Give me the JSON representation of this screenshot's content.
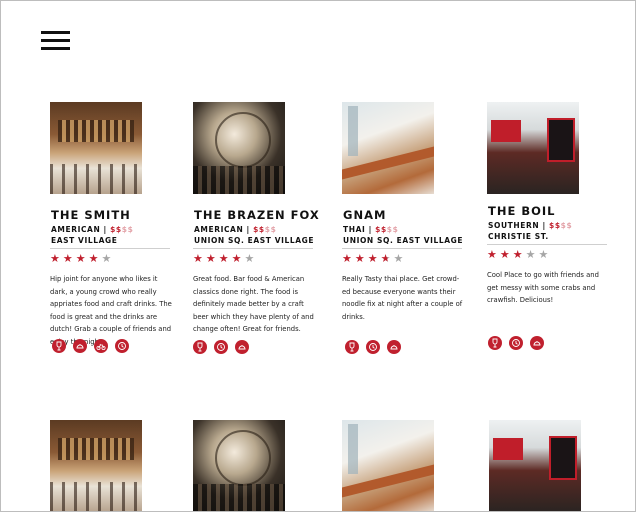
{
  "restaurants": [
    {
      "name": "THE SMITH",
      "cuisine": "AMERICAN",
      "price_on": "$$",
      "price_off": "$$",
      "neighborhood": "EAST VILLAGE",
      "rating": 4,
      "rating_max": 5,
      "description": "Hip joint for anyone who likes it dark, a young crowd who really appriates food and craft drinks. The food is great and the drinks are dutch! Grab a couple of friends and enjoy the night.",
      "features": [
        "wine-icon",
        "dessert-icon",
        "bike-icon",
        "clock-icon"
      ]
    },
    {
      "name": "THE BRAZEN FOX",
      "cuisine": "AMERICAN",
      "price_on": "$$",
      "price_off": "$$",
      "neighborhood": "UNION SQ. EAST VILLAGE",
      "rating": 4,
      "rating_max": 5,
      "description": "Great food.  Bar food & American classics done right.  The food is definitely made better by a craft beer which they have plenty of and change often! Great for friends.",
      "features": [
        "wine-icon",
        "clock-icon",
        "dessert-icon"
      ]
    },
    {
      "name": "GNAM",
      "cuisine": "THAI",
      "price_on": "$$",
      "price_off": "$$",
      "neighborhood": "UNION SQ. EAST VILLAGE",
      "rating": 3.5,
      "rating_max": 5,
      "description": "Really Tasty thai place.  Get crowd- ed because everyone wants their noodle fix at night after a couple of drinks.",
      "features": [
        "wine-icon",
        "clock-icon",
        "dessert-icon"
      ]
    },
    {
      "name": "THE BOIL",
      "cuisine": "SOUTHERN",
      "price_on": "$$",
      "price_off": "$$",
      "neighborhood": "CHRISTIE ST.",
      "rating": 3,
      "rating_max": 5,
      "description": "Cool Place to go with friends and get messy with some crabs and crawfish.  Delicious!",
      "features": [
        "wine-icon",
        "clock-icon",
        "dessert-icon"
      ]
    }
  ],
  "colors": {
    "accent": "#c0202e",
    "price_off": "#e3a2a8",
    "star_off": "#a6a6a6"
  }
}
